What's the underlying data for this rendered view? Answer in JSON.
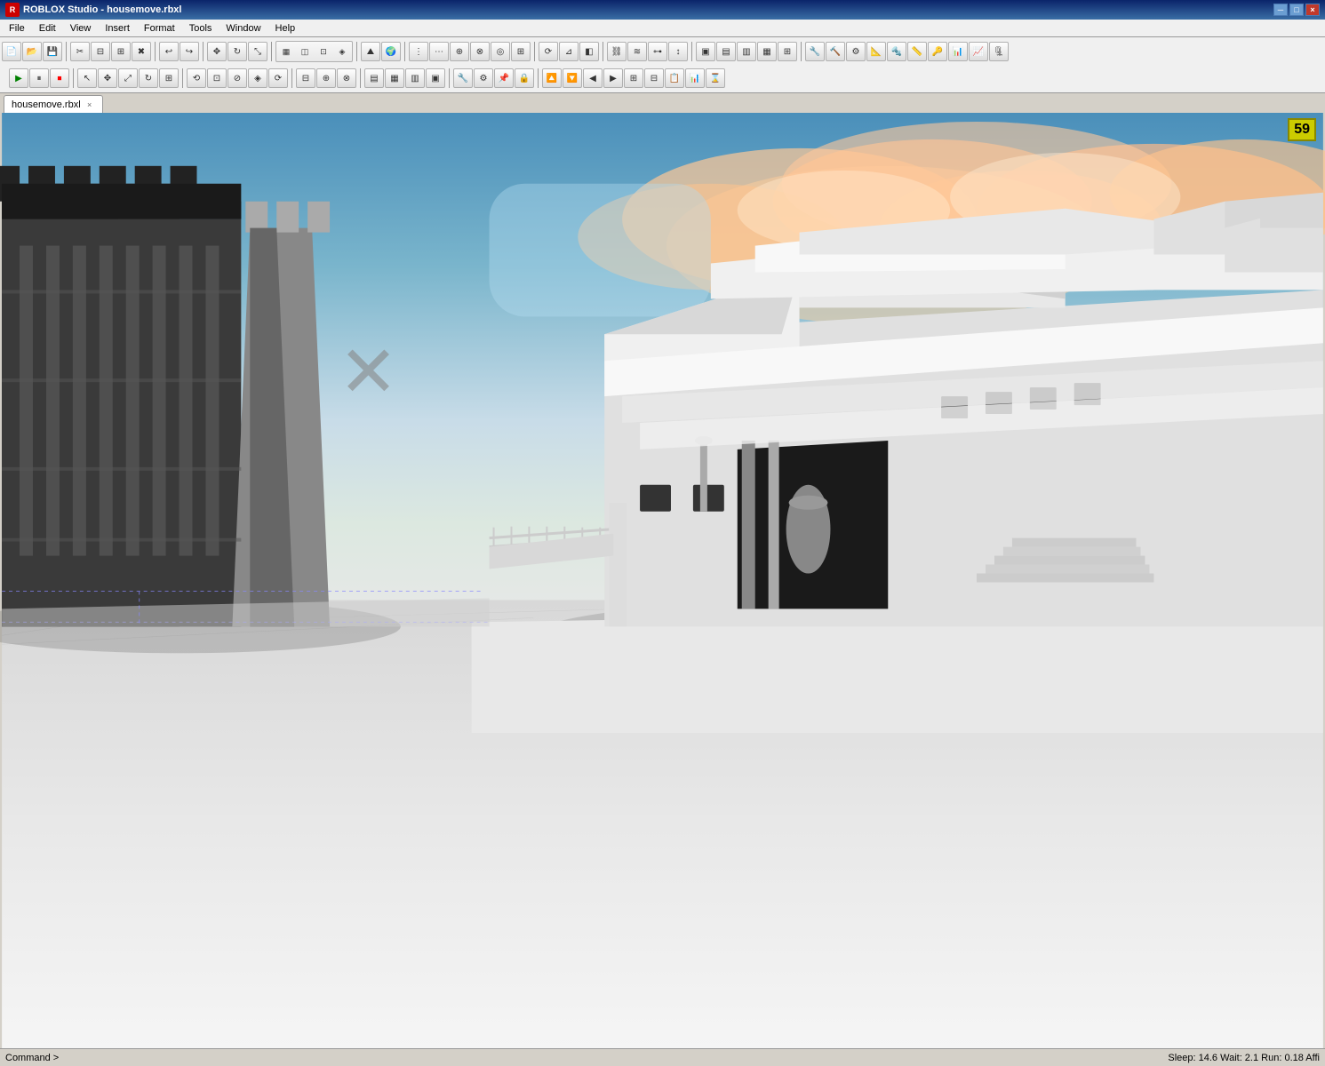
{
  "window": {
    "title": "ROBLOX Studio - housemove.rbxl",
    "icon": "R"
  },
  "menu": {
    "items": [
      "File",
      "Edit",
      "View",
      "Insert",
      "Format",
      "Tools",
      "Window",
      "Help"
    ]
  },
  "toolbar": {
    "row1_groups": [
      {
        "id": "file-ops",
        "buttons": [
          "new",
          "open",
          "save",
          "saveas"
        ]
      },
      {
        "id": "clipboard",
        "buttons": [
          "cut",
          "copy",
          "paste"
        ]
      },
      {
        "id": "history",
        "buttons": [
          "undo",
          "redo"
        ]
      },
      {
        "id": "transform",
        "buttons": [
          "move",
          "scale",
          "rotate",
          "select"
        ]
      },
      {
        "id": "insert",
        "buttons": [
          "part",
          "model",
          "special"
        ]
      },
      {
        "id": "terrain",
        "buttons": [
          "terrain1",
          "terrain2"
        ]
      },
      {
        "id": "grid",
        "buttons": [
          "grid1",
          "grid2",
          "grid3"
        ]
      },
      {
        "id": "camera",
        "buttons": [
          "cam1",
          "cam2",
          "cam3"
        ]
      }
    ],
    "row2_groups": [
      {
        "id": "play-controls",
        "buttons": [
          "play",
          "pause",
          "stop"
        ]
      },
      {
        "id": "tools",
        "buttons": [
          "select",
          "move",
          "scale",
          "rotate",
          "transform",
          "weld"
        ]
      },
      {
        "id": "view-controls",
        "buttons": [
          "zoom-in",
          "zoom-out",
          "pan",
          "orbit"
        ]
      },
      {
        "id": "snap",
        "buttons": [
          "snap1",
          "snap2",
          "snap3"
        ]
      },
      {
        "id": "parts",
        "buttons": [
          "part1",
          "part2",
          "part3",
          "part4"
        ]
      },
      {
        "id": "misc",
        "buttons": [
          "misc1",
          "misc2",
          "misc3"
        ]
      }
    ]
  },
  "tab": {
    "label": "housemove.rbxl",
    "close_label": "×"
  },
  "viewport": {
    "fps": "59",
    "fps_label": "59"
  },
  "status": {
    "left": "Command >",
    "right": "Sleep: 14.6 Wait: 2.1 Run: 0.18 Affi"
  },
  "scene": {
    "sky_color_top": "#7ab8d4",
    "sky_color_bottom": "#e0e8f0",
    "cloud_color": "rgba(240,180,120,0.7)",
    "ground_color": "#f0f0f0",
    "building_color": "#e0e0e0"
  },
  "icons": {
    "new": "📄",
    "open": "📂",
    "save": "💾",
    "cut": "✂",
    "copy": "📋",
    "paste": "📌",
    "undo": "↩",
    "redo": "↪",
    "play": "▶",
    "pause": "⏸",
    "stop": "⏹",
    "move": "✥",
    "rotate": "↻",
    "scale": "⤢",
    "select": "↖",
    "close": "×",
    "minimize": "─",
    "maximize": "□"
  }
}
